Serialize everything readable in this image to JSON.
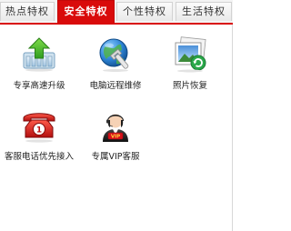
{
  "tabs": [
    {
      "label": "热点特权",
      "active": false
    },
    {
      "label": "安全特权",
      "active": true
    },
    {
      "label": "个性特权",
      "active": false
    },
    {
      "label": "生活特权",
      "active": false
    }
  ],
  "items": [
    {
      "label": "专享高速升级",
      "icon": "upgrade-arrow-icon"
    },
    {
      "label": "电脑远程维修",
      "icon": "globe-wrench-icon"
    },
    {
      "label": "照片恢复",
      "icon": "photo-restore-icon"
    },
    {
      "label": "客服电话优先接入",
      "icon": "red-phone-icon"
    },
    {
      "label": "专属VIP客服",
      "icon": "vip-agent-icon"
    }
  ],
  "colors": {
    "accent": "#d90b0b",
    "tab_bg": "#f3f3f3",
    "text": "#222222"
  }
}
